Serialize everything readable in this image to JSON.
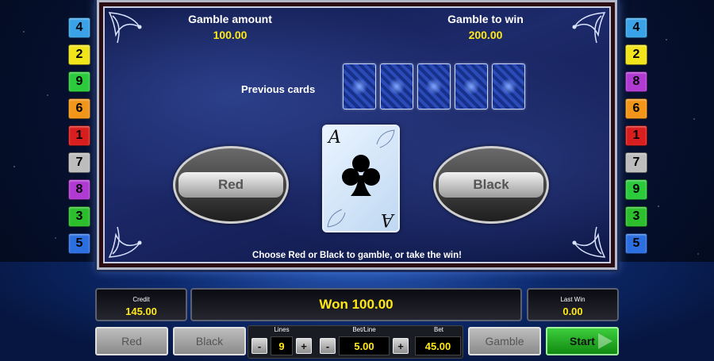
{
  "lines_left": [
    {
      "n": "4",
      "color": "#3aa3e8"
    },
    {
      "n": "2",
      "color": "#f1e41a"
    },
    {
      "n": "9",
      "color": "#2ccb3c"
    },
    {
      "n": "6",
      "color": "#f2961a"
    },
    {
      "n": "1",
      "color": "#d81e1e"
    },
    {
      "n": "7",
      "color": "#bdbdbd"
    },
    {
      "n": "8",
      "color": "#b03ad2"
    },
    {
      "n": "3",
      "color": "#2cbe2c"
    },
    {
      "n": "5",
      "color": "#2c6fe0"
    }
  ],
  "lines_right": [
    {
      "n": "4",
      "color": "#3aa3e8"
    },
    {
      "n": "2",
      "color": "#f1e41a"
    },
    {
      "n": "8",
      "color": "#b03ad2"
    },
    {
      "n": "6",
      "color": "#f2961a"
    },
    {
      "n": "1",
      "color": "#d81e1e"
    },
    {
      "n": "7",
      "color": "#bdbdbd"
    },
    {
      "n": "9",
      "color": "#2ccb3c"
    },
    {
      "n": "3",
      "color": "#2cbe2c"
    },
    {
      "n": "5",
      "color": "#2c6fe0"
    }
  ],
  "gamble": {
    "amount_label": "Gamble amount",
    "amount_value": "100.00",
    "to_win_label": "Gamble to win",
    "to_win_value": "200.00",
    "previous_cards_label": "Previous cards",
    "red_label": "Red",
    "black_label": "Black",
    "card_rank": "A",
    "instruction": "Choose Red or Black to gamble, or take the win!"
  },
  "status": {
    "credit_label": "Credit",
    "credit_value": "145.00",
    "won_text": "Won 100.00",
    "last_win_label": "Last Win",
    "last_win_value": "0.00"
  },
  "controls": {
    "red_button": "Red",
    "black_button": "Black",
    "lines_label": "Lines",
    "lines_value": "9",
    "betline_label": "Bet/Line",
    "betline_value": "5.00",
    "bet_label": "Bet",
    "bet_value": "45.00",
    "gamble_button": "Gamble",
    "start_button": "Start",
    "minus": "-",
    "plus": "+"
  }
}
